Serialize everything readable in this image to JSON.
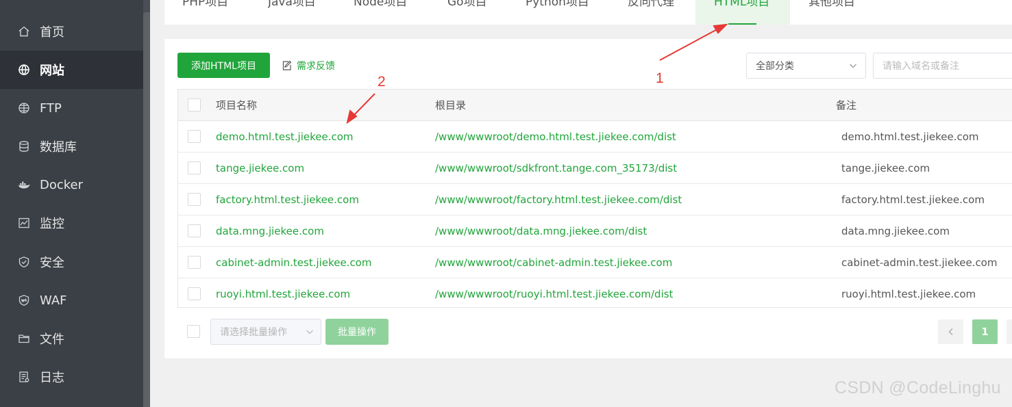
{
  "sidebar": {
    "items": [
      {
        "label": "首页",
        "icon": "home-icon",
        "active": false
      },
      {
        "label": "网站",
        "icon": "globe-icon",
        "active": true
      },
      {
        "label": "FTP",
        "icon": "ftp-globe-icon",
        "active": false
      },
      {
        "label": "数据库",
        "icon": "database-icon",
        "active": false
      },
      {
        "label": "Docker",
        "icon": "docker-icon",
        "active": false
      },
      {
        "label": "监控",
        "icon": "monitor-icon",
        "active": false
      },
      {
        "label": "安全",
        "icon": "shield-icon",
        "active": false
      },
      {
        "label": "WAF",
        "icon": "waf-shield-icon",
        "active": false
      },
      {
        "label": "文件",
        "icon": "folder-icon",
        "active": false
      },
      {
        "label": "日志",
        "icon": "log-icon",
        "active": false
      }
    ]
  },
  "tabs": [
    {
      "label": "PHP项目",
      "active": false
    },
    {
      "label": "Java项目",
      "active": false
    },
    {
      "label": "Node项目",
      "active": false
    },
    {
      "label": "Go项目",
      "active": false
    },
    {
      "label": "Python项目",
      "active": false
    },
    {
      "label": "反向代理",
      "active": false
    },
    {
      "label": "HTML项目",
      "active": true
    },
    {
      "label": "其他项目",
      "active": false
    }
  ],
  "toolbar": {
    "add_label": "添加HTML项目",
    "feedback_label": "需求反馈",
    "category_value": "全部分类",
    "search_placeholder": "请输入域名或备注"
  },
  "table": {
    "headers": {
      "name": "项目名称",
      "root": "根目录",
      "remark": "备注"
    },
    "rows": [
      {
        "name": "demo.html.test.jiekee.com",
        "root": "/www/wwwroot/demo.html.test.jiekee.com/dist",
        "remark": "demo.html.test.jiekee.com"
      },
      {
        "name": "tange.jiekee.com",
        "root": "/www/wwwroot/sdkfront.tange.com_35173/dist",
        "remark": "tange.jiekee.com"
      },
      {
        "name": "factory.html.test.jiekee.com",
        "root": "/www/wwwroot/factory.html.test.jiekee.com/dist",
        "remark": "factory.html.test.jiekee.com"
      },
      {
        "name": "data.mng.jiekee.com",
        "root": "/www/wwwroot/data.mng.jiekee.com/dist",
        "remark": "data.mng.jiekee.com"
      },
      {
        "name": "cabinet-admin.test.jiekee.com",
        "root": "/www/wwwroot/cabinet-admin.test.jiekee.com",
        "remark": "cabinet-admin.test.jiekee.com"
      },
      {
        "name": "ruoyi.html.test.jiekee.com",
        "root": "/www/wwwroot/ruoyi.html.test.jiekee.com/dist",
        "remark": "ruoyi.html.test.jiekee.com"
      }
    ]
  },
  "footer": {
    "batch_placeholder": "请选择批量操作",
    "batch_button": "批量操作",
    "page_current": "1"
  },
  "annotations": {
    "label1": "1",
    "label2": "2",
    "color": "#e53935"
  },
  "watermark": "CSDN @CodeLinghu",
  "colors": {
    "accent": "#20a53a",
    "sidebar_bg": "#3b4046",
    "sidebar_active": "#2e3238"
  }
}
